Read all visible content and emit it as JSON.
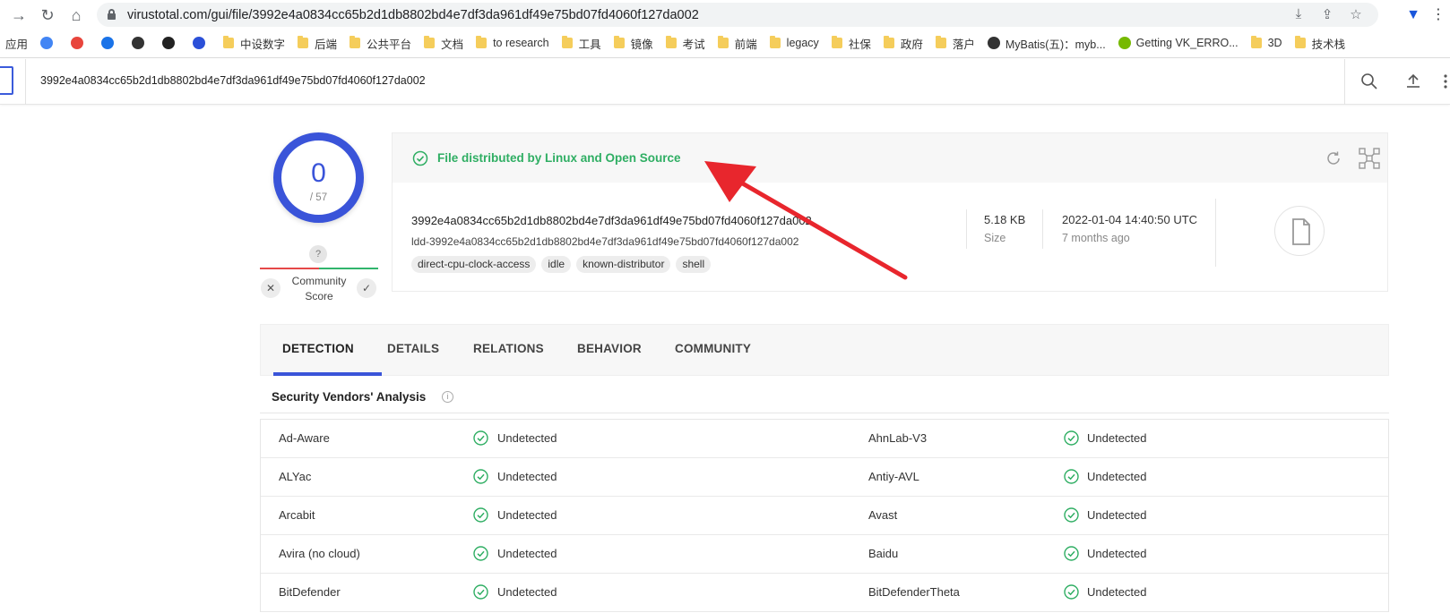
{
  "browser": {
    "url_host": "virustotal.com/gui/file/3992e4a0834cc65b2d1db8802bd4e7df3da961df49e75bd07fd4060f127da002",
    "bookmarks": [
      {
        "label": "应用",
        "kind": "apps"
      },
      {
        "label": "",
        "kind": "icon",
        "color": "#4285f4"
      },
      {
        "label": "",
        "kind": "icon",
        "color": "#e8453c"
      },
      {
        "label": "",
        "kind": "icon",
        "color": "#1a73e8"
      },
      {
        "label": "",
        "kind": "icon",
        "color": "#333333"
      },
      {
        "label": "",
        "kind": "icon",
        "color": "#222222"
      },
      {
        "label": "",
        "kind": "icon",
        "color": "#2b50d8"
      },
      {
        "label": "中设数字",
        "kind": "folder"
      },
      {
        "label": "后端",
        "kind": "folder"
      },
      {
        "label": "公共平台",
        "kind": "folder"
      },
      {
        "label": "文档",
        "kind": "folder"
      },
      {
        "label": "to research",
        "kind": "folder"
      },
      {
        "label": "工具",
        "kind": "folder"
      },
      {
        "label": "镜像",
        "kind": "folder"
      },
      {
        "label": "考试",
        "kind": "folder"
      },
      {
        "label": "前端",
        "kind": "folder"
      },
      {
        "label": "legacy",
        "kind": "folder"
      },
      {
        "label": "社保",
        "kind": "folder"
      },
      {
        "label": "政府",
        "kind": "folder"
      },
      {
        "label": "落户",
        "kind": "folder"
      },
      {
        "label": "MyBatis(五)：myb...",
        "kind": "github"
      },
      {
        "label": "Getting VK_ERRO...",
        "kind": "nvidia"
      },
      {
        "label": "3D",
        "kind": "folder"
      },
      {
        "label": "技术栈",
        "kind": "folder"
      }
    ]
  },
  "vt_bar": {
    "hash_query": "3992e4a0834cc65b2d1db8802bd4e7df3da961df49e75bd07fd4060f127da002"
  },
  "score": {
    "detections": "0",
    "total": "/ 57",
    "unknown_badge": "?",
    "community_label": "Community Score",
    "accent": "#3a54d9"
  },
  "summary": {
    "distributor_text": "File distributed by Linux and Open Source",
    "sha256": "3992e4a0834cc65b2d1db8802bd4e7df3da961df49e75bd07fd4060f127da002",
    "filename": "ldd-3992e4a0834cc65b2d1db8802bd4e7df3da961df49e75bd07fd4060f127da002",
    "tags": [
      "direct-cpu-clock-access",
      "idle",
      "known-distributor",
      "shell"
    ],
    "size_value": "5.18 KB",
    "size_label": "Size",
    "date_value": "2022-01-04 14:40:50 UTC",
    "date_label": "7 months ago",
    "success_color": "#2fae63"
  },
  "tabs": [
    {
      "label": "DETECTION",
      "active": true
    },
    {
      "label": "DETAILS",
      "active": false
    },
    {
      "label": "RELATIONS",
      "active": false
    },
    {
      "label": "BEHAVIOR",
      "active": false
    },
    {
      "label": "COMMUNITY",
      "active": false
    }
  ],
  "analysis": {
    "title": "Security Vendors' Analysis",
    "info_glyph": "i",
    "rows": [
      {
        "left_vendor": "Ad-Aware",
        "left_status": "Undetected",
        "right_vendor": "AhnLab-V3",
        "right_status": "Undetected"
      },
      {
        "left_vendor": "ALYac",
        "left_status": "Undetected",
        "right_vendor": "Antiy-AVL",
        "right_status": "Undetected"
      },
      {
        "left_vendor": "Arcabit",
        "left_status": "Undetected",
        "right_vendor": "Avast",
        "right_status": "Undetected"
      },
      {
        "left_vendor": "Avira (no cloud)",
        "left_status": "Undetected",
        "right_vendor": "Baidu",
        "right_status": "Undetected"
      },
      {
        "left_vendor": "BitDefender",
        "left_status": "Undetected",
        "right_vendor": "BitDefenderTheta",
        "right_status": "Undetected"
      }
    ]
  },
  "annotation": {
    "arrow_color": "#e8262d"
  }
}
